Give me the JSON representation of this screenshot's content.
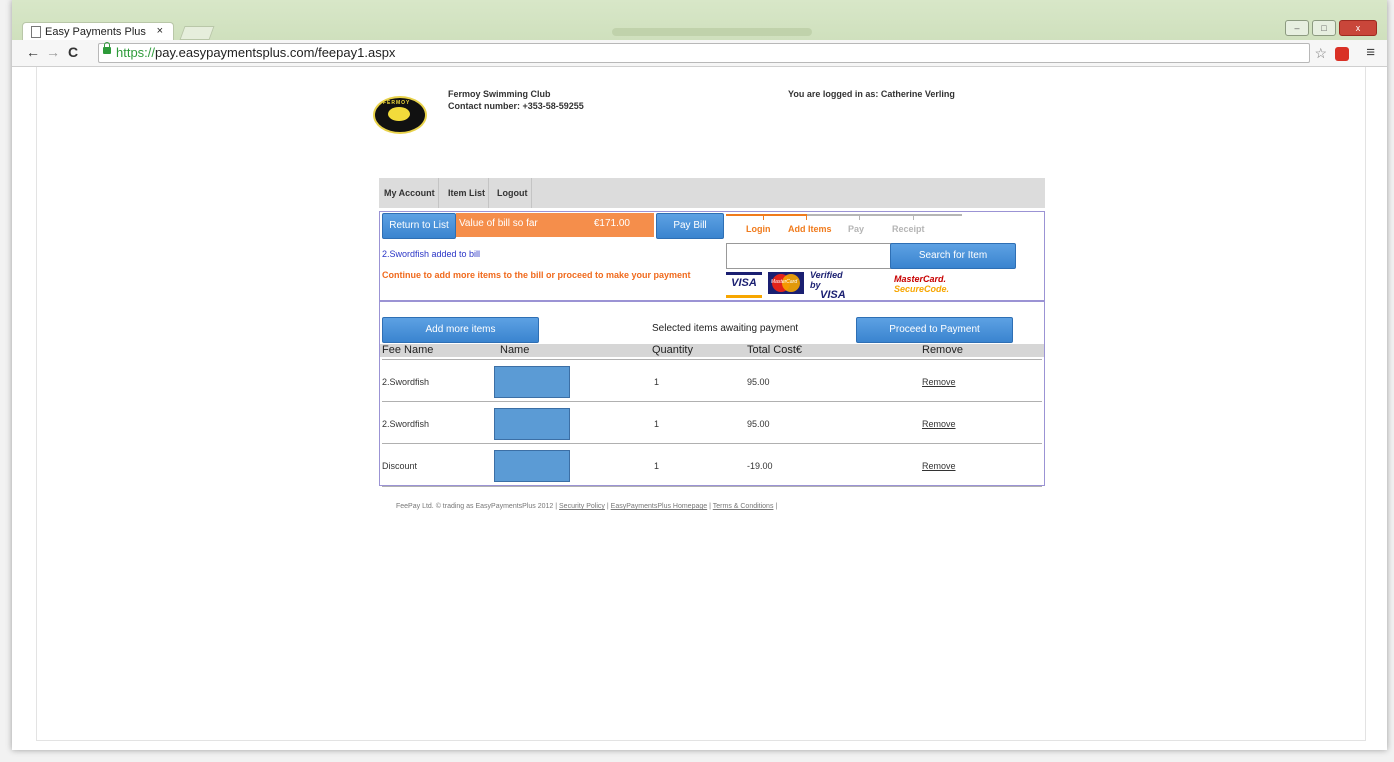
{
  "browser": {
    "tab_title": "Easy Payments Plus",
    "tab_close": "×",
    "url_scheme": "https://",
    "url_rest": "pay.easypaymentsplus.com/feepay1.aspx",
    "back": "←",
    "forward": "→",
    "reload": "C",
    "star": "☆",
    "menu": "≡",
    "min": "–",
    "max": "□",
    "close": "x"
  },
  "header": {
    "club_name": "Fermoy Swimming Club",
    "contact": "Contact number: +353-58-59255",
    "logged_in": "You are logged in as: Catherine Verling",
    "logo_text": "FERMOY"
  },
  "menu": {
    "items": [
      "My Account",
      "Item List",
      "Logout"
    ]
  },
  "bill": {
    "return_label": "Return to List",
    "value_label": "Value of bill so far",
    "value": "€171.00",
    "pay_label": "Pay Bill",
    "added_message": "2.Swordfish added to bill",
    "continue_message": "Continue to add more items to the bill or proceed to make your payment"
  },
  "steps": {
    "items": [
      "Login",
      "Add Items",
      "Pay",
      "Receipt"
    ],
    "active_color": "#f07b1d",
    "inactive_color": "#b5b5b5"
  },
  "search": {
    "button_label": "Search for Item",
    "value": ""
  },
  "cards": {
    "visa": "VISA",
    "mastercard": "MasterCard",
    "verified_by": "Verified by",
    "verified_visa": "VISA",
    "mc_secure_1": "MasterCard.",
    "mc_secure_2": "SecureCode."
  },
  "items": {
    "add_more_label": "Add more items",
    "selected_label": "Selected items awaiting payment",
    "proceed_label": "Proceed to Payment",
    "columns": [
      "Fee Name",
      "Name",
      "Quantity",
      "Total Cost€",
      "Remove"
    ],
    "rows": [
      {
        "fee": "2.Swordfish",
        "qty": "1",
        "total": "95.00",
        "remove": "Remove"
      },
      {
        "fee": "2.Swordfish",
        "qty": "1",
        "total": "95.00",
        "remove": "Remove"
      },
      {
        "fee": "Discount",
        "qty": "1",
        "total": "-19.00",
        "remove": "Remove"
      }
    ]
  },
  "footer": {
    "text": "FeePay Ltd. © trading as EasyPaymentsPlus 2012 |",
    "link1": "Security Policy",
    "sep1": "|",
    "link2": "EasyPaymentsPlus Homepage",
    "sep2": "|",
    "link3": "Terms & Conditions",
    "sep3": "|"
  },
  "colors": {
    "accent_blue": "#3a84cf",
    "bill_orange": "#f58e4b",
    "message_blue": "#2a35c6",
    "message_orange": "#f06a1d"
  }
}
